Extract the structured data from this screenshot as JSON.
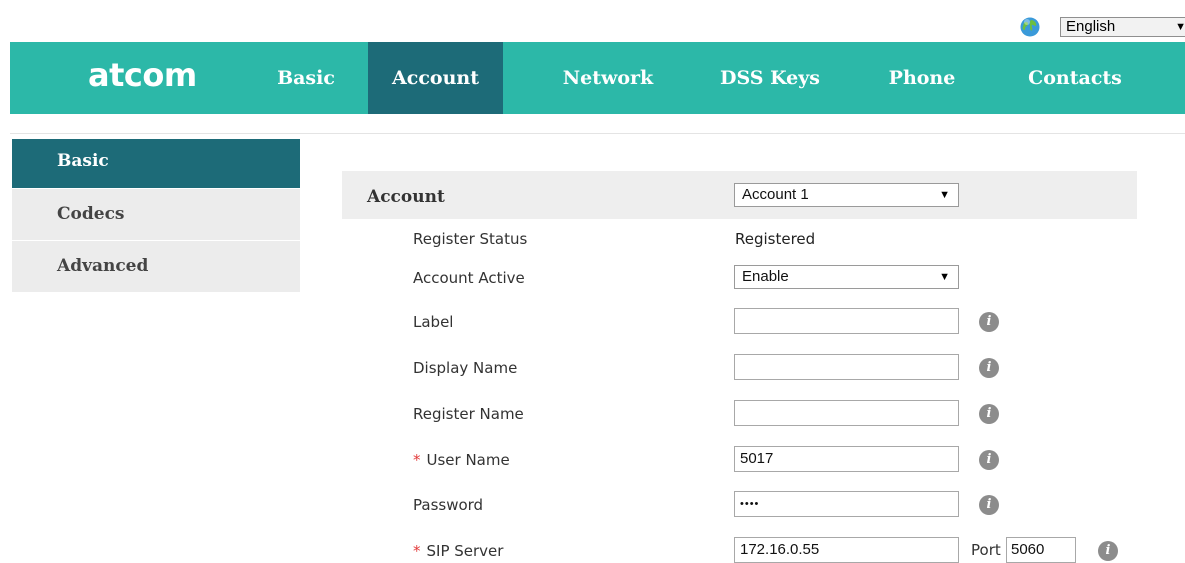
{
  "language": {
    "selected": "English",
    "icon": "globe-icon"
  },
  "brand": {
    "logo_text": "atcom",
    "nav_color": "#2cb8a8",
    "active_color": "#1d6b78"
  },
  "nav": {
    "items": [
      {
        "label": "Basic"
      },
      {
        "label": "Account",
        "active": true
      },
      {
        "label": "Network"
      },
      {
        "label": "DSS Keys"
      },
      {
        "label": "Phone"
      },
      {
        "label": "Contacts"
      }
    ]
  },
  "sidebar": {
    "items": [
      {
        "label": "Basic",
        "active": true
      },
      {
        "label": "Codecs"
      },
      {
        "label": "Advanced"
      }
    ]
  },
  "form": {
    "account": {
      "label": "Account",
      "value": "Account 1"
    },
    "register_status": {
      "label": "Register Status",
      "value": "Registered"
    },
    "account_active": {
      "label": "Account Active",
      "value": "Enable"
    },
    "label_field": {
      "label": "Label",
      "value": ""
    },
    "display_name": {
      "label": "Display Name",
      "value": ""
    },
    "register_name": {
      "label": "Register Name",
      "value": ""
    },
    "user_name": {
      "label": "User Name",
      "required_mark": "*",
      "value": "5017"
    },
    "password": {
      "label": "Password",
      "value": "••••"
    },
    "sip_server": {
      "label": "SIP Server",
      "required_mark": "*",
      "value": "172.16.0.55",
      "port_label": "Port",
      "port_value": "5060"
    },
    "info_glyph": "i"
  }
}
